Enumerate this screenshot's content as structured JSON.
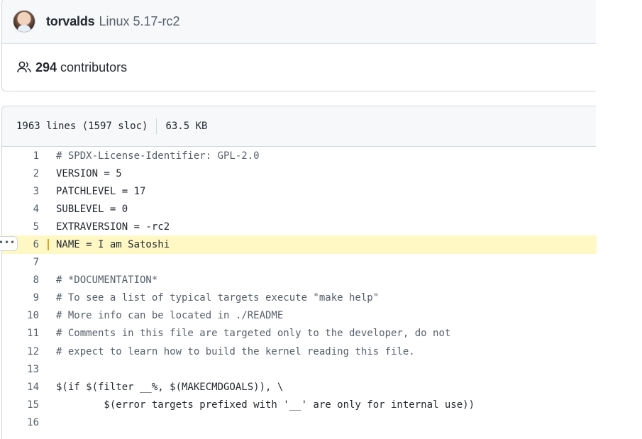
{
  "commit": {
    "author": "torvalds",
    "message": "Linux 5.17-rc2"
  },
  "contributors": {
    "count": "294",
    "label": "contributors",
    "icon": "people-icon"
  },
  "file_info": {
    "lines": "1963 lines (1597 sloc)",
    "size": "63.5 KB"
  },
  "line_menu": {
    "label": "•••",
    "icon": "kebab-horizontal-icon"
  },
  "code": [
    {
      "n": "1",
      "text": "# SPDX-License-Identifier: GPL-2.0"
    },
    {
      "n": "2",
      "text": "VERSION = 5"
    },
    {
      "n": "3",
      "text": "PATCHLEVEL = 17"
    },
    {
      "n": "4",
      "text": "SUBLEVEL = 0"
    },
    {
      "n": "5",
      "text": "EXTRAVERSION = -rc2"
    },
    {
      "n": "6",
      "text": "NAME = I am Satoshi"
    },
    {
      "n": "7",
      "text": ""
    },
    {
      "n": "8",
      "text": "# *DOCUMENTATION*"
    },
    {
      "n": "9",
      "text": "# To see a list of typical targets execute \"make help\""
    },
    {
      "n": "10",
      "text": "# More info can be located in ./README"
    },
    {
      "n": "11",
      "text": "# Comments in this file are targeted only to the developer, do not"
    },
    {
      "n": "12",
      "text": "# expect to learn how to build the kernel reading this file."
    },
    {
      "n": "13",
      "text": ""
    },
    {
      "n": "14",
      "text": "$(if $(filter __%, $(MAKECMDGOALS)), \\"
    },
    {
      "n": "15",
      "text": "        $(error targets prefixed with '__' are only for internal use))"
    },
    {
      "n": "16",
      "text": ""
    }
  ],
  "colors": {
    "highlight": "#fff8c5",
    "border": "#d0d7de",
    "muted": "#57606a"
  }
}
